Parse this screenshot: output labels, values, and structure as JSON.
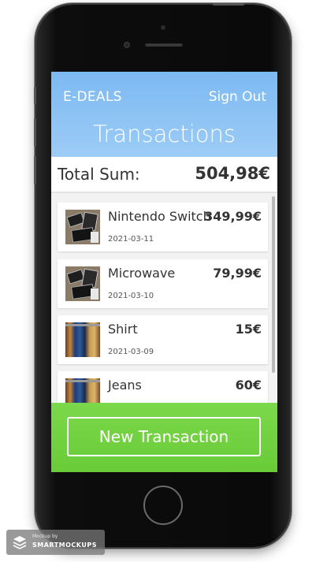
{
  "app": {
    "brand": "E-DEALS",
    "sign_out_label": "Sign Out",
    "page_title": "Transactions"
  },
  "total": {
    "label": "Total Sum:",
    "value": "504,98€"
  },
  "transactions": [
    {
      "name": "Nintendo Switch",
      "price": "349,99€",
      "date": "2021-03-11",
      "thumb": "tech-gadgets-image"
    },
    {
      "name": "Microwave",
      "price": "79,99€",
      "date": "2021-03-10",
      "thumb": "tech-gadgets-image"
    },
    {
      "name": "Shirt",
      "price": "15€",
      "date": "2021-03-09",
      "thumb": "clothes-rack-image"
    },
    {
      "name": "Jeans",
      "price": "60€",
      "date": "",
      "thumb": "clothes-rack-image"
    }
  ],
  "footer": {
    "new_transaction_label": "New Transaction"
  },
  "watermark": {
    "small_text": "Mockup by",
    "brand_text": "SMARTMOCKUPS"
  },
  "colors": {
    "header_blue": "#8cc2f4",
    "footer_green": "#72d141",
    "text_dark": "#333333"
  }
}
